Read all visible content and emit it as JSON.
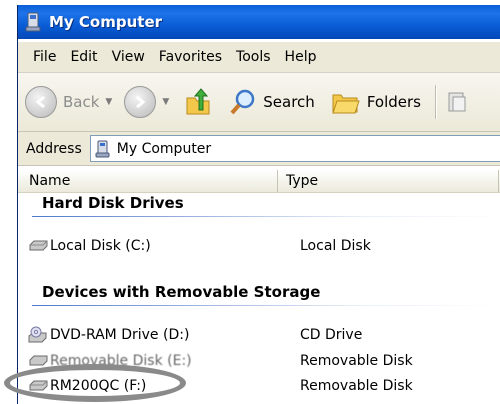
{
  "window": {
    "title": "My Computer"
  },
  "menu": {
    "items": [
      {
        "label": "File",
        "name": "menu-file"
      },
      {
        "label": "Edit",
        "name": "menu-edit"
      },
      {
        "label": "View",
        "name": "menu-view"
      },
      {
        "label": "Favorites",
        "name": "menu-favorites"
      },
      {
        "label": "Tools",
        "name": "menu-tools"
      },
      {
        "label": "Help",
        "name": "menu-help"
      }
    ]
  },
  "toolbar": {
    "back_label": "Back",
    "search_label": "Search",
    "folders_label": "Folders"
  },
  "address": {
    "label": "Address",
    "value": "My Computer"
  },
  "columns": {
    "name": "Name",
    "type": "Type"
  },
  "groups": {
    "hard_disk": "Hard Disk Drives",
    "removable": "Devices with Removable Storage"
  },
  "drives": {
    "local": {
      "name": "Local Disk (C:)",
      "type": "Local Disk"
    },
    "dvd": {
      "name": "DVD-RAM Drive (D:)",
      "type": "CD Drive"
    },
    "removable_e": {
      "name": "Removable Disk (E:)",
      "type": "Removable Disk"
    },
    "rm200": {
      "name": "RM200QC (F:)",
      "type": "Removable Disk"
    }
  },
  "colors": {
    "titlebar": "#0a5fd8",
    "annotation_circle": "#8a8a8a"
  }
}
